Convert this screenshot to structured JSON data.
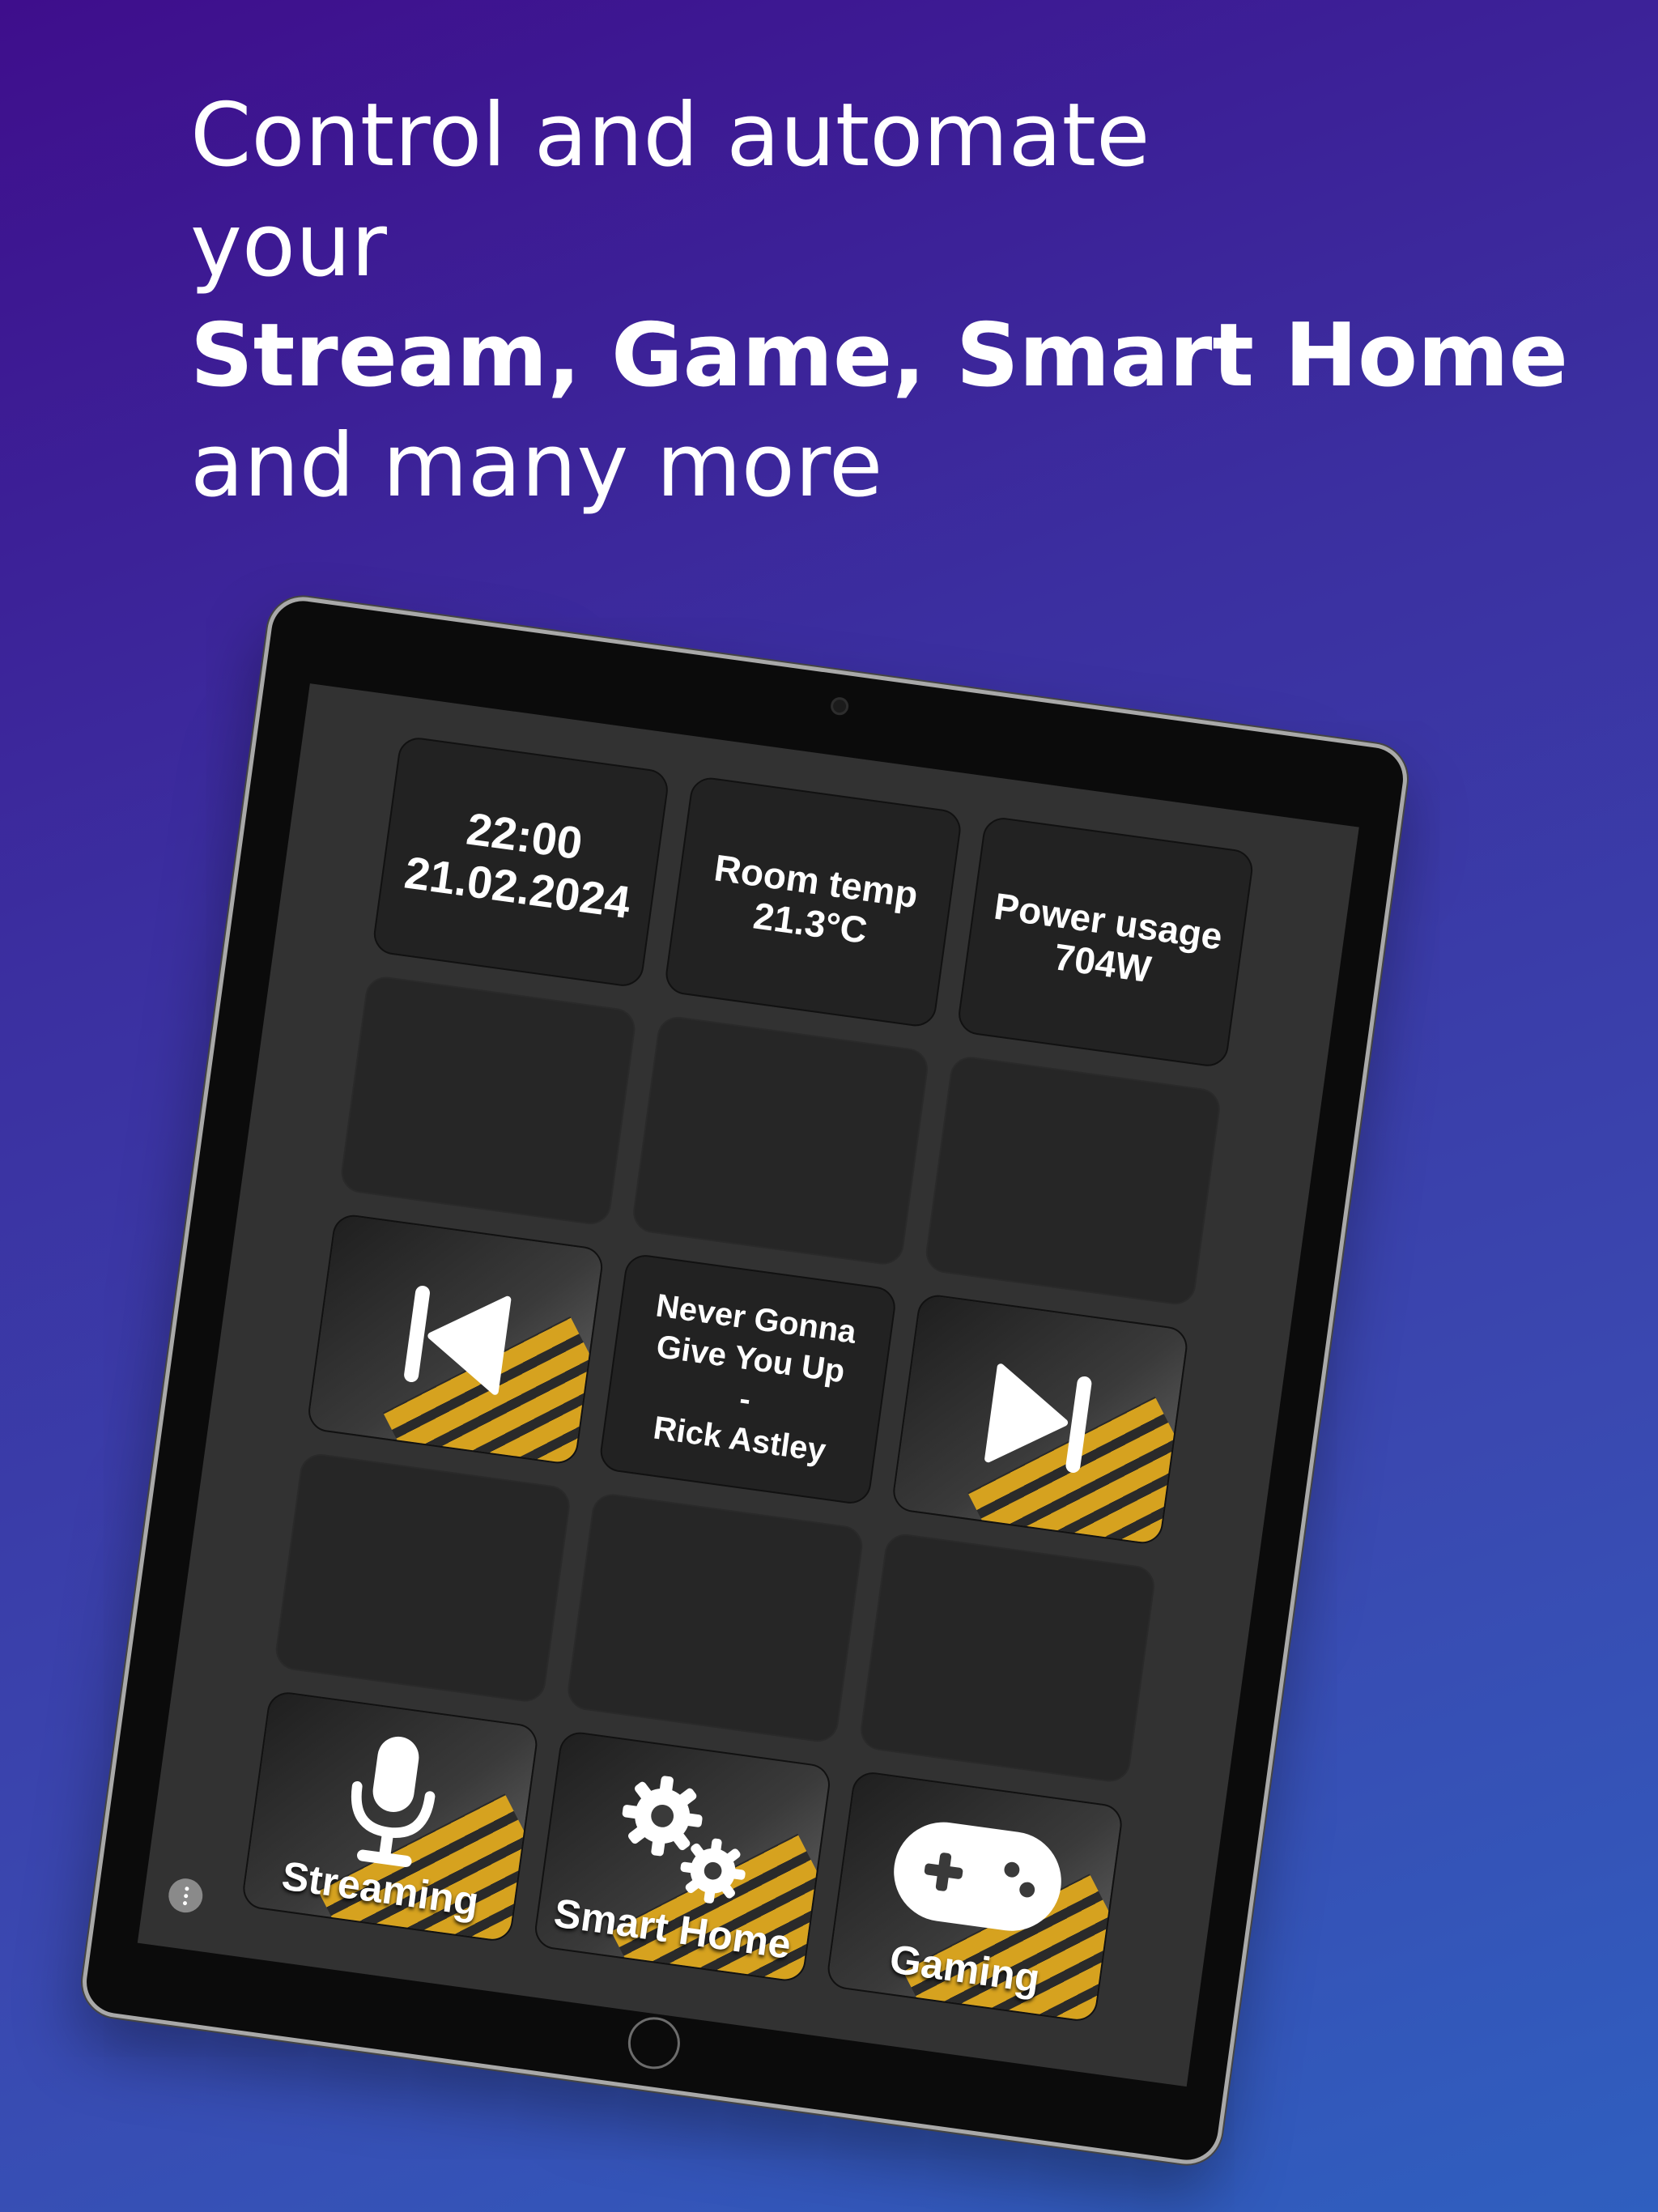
{
  "headline": {
    "line1": "Control and automate",
    "line2": "your",
    "line3_bold": "Stream, Game, Smart Home",
    "line4": "and many more"
  },
  "tiles": {
    "time": "22:00",
    "date": "21.02.2024",
    "room_temp_label": "Room temp",
    "room_temp_value": "21.3°C",
    "power_label": "Power usage",
    "power_value": "704W",
    "song_title_1": "Never Gonna",
    "song_title_2": "Give You Up",
    "song_sep": "-",
    "song_artist": "Rick Astley",
    "streaming_label": "Streaming",
    "smarthome_label": "Smart Home",
    "gaming_label": "Gaming"
  },
  "icons": {
    "previous": "skip-previous-icon",
    "next": "skip-next-icon",
    "streaming": "microphone-icon",
    "smarthome": "gears-icon",
    "gaming": "gamepad-icon",
    "menu": "more-vertical-icon"
  },
  "colors": {
    "accent_stripe": "#d6a21f",
    "tile_background": "#222222",
    "screen_background": "#323232",
    "headline_text": "#ffffff"
  }
}
